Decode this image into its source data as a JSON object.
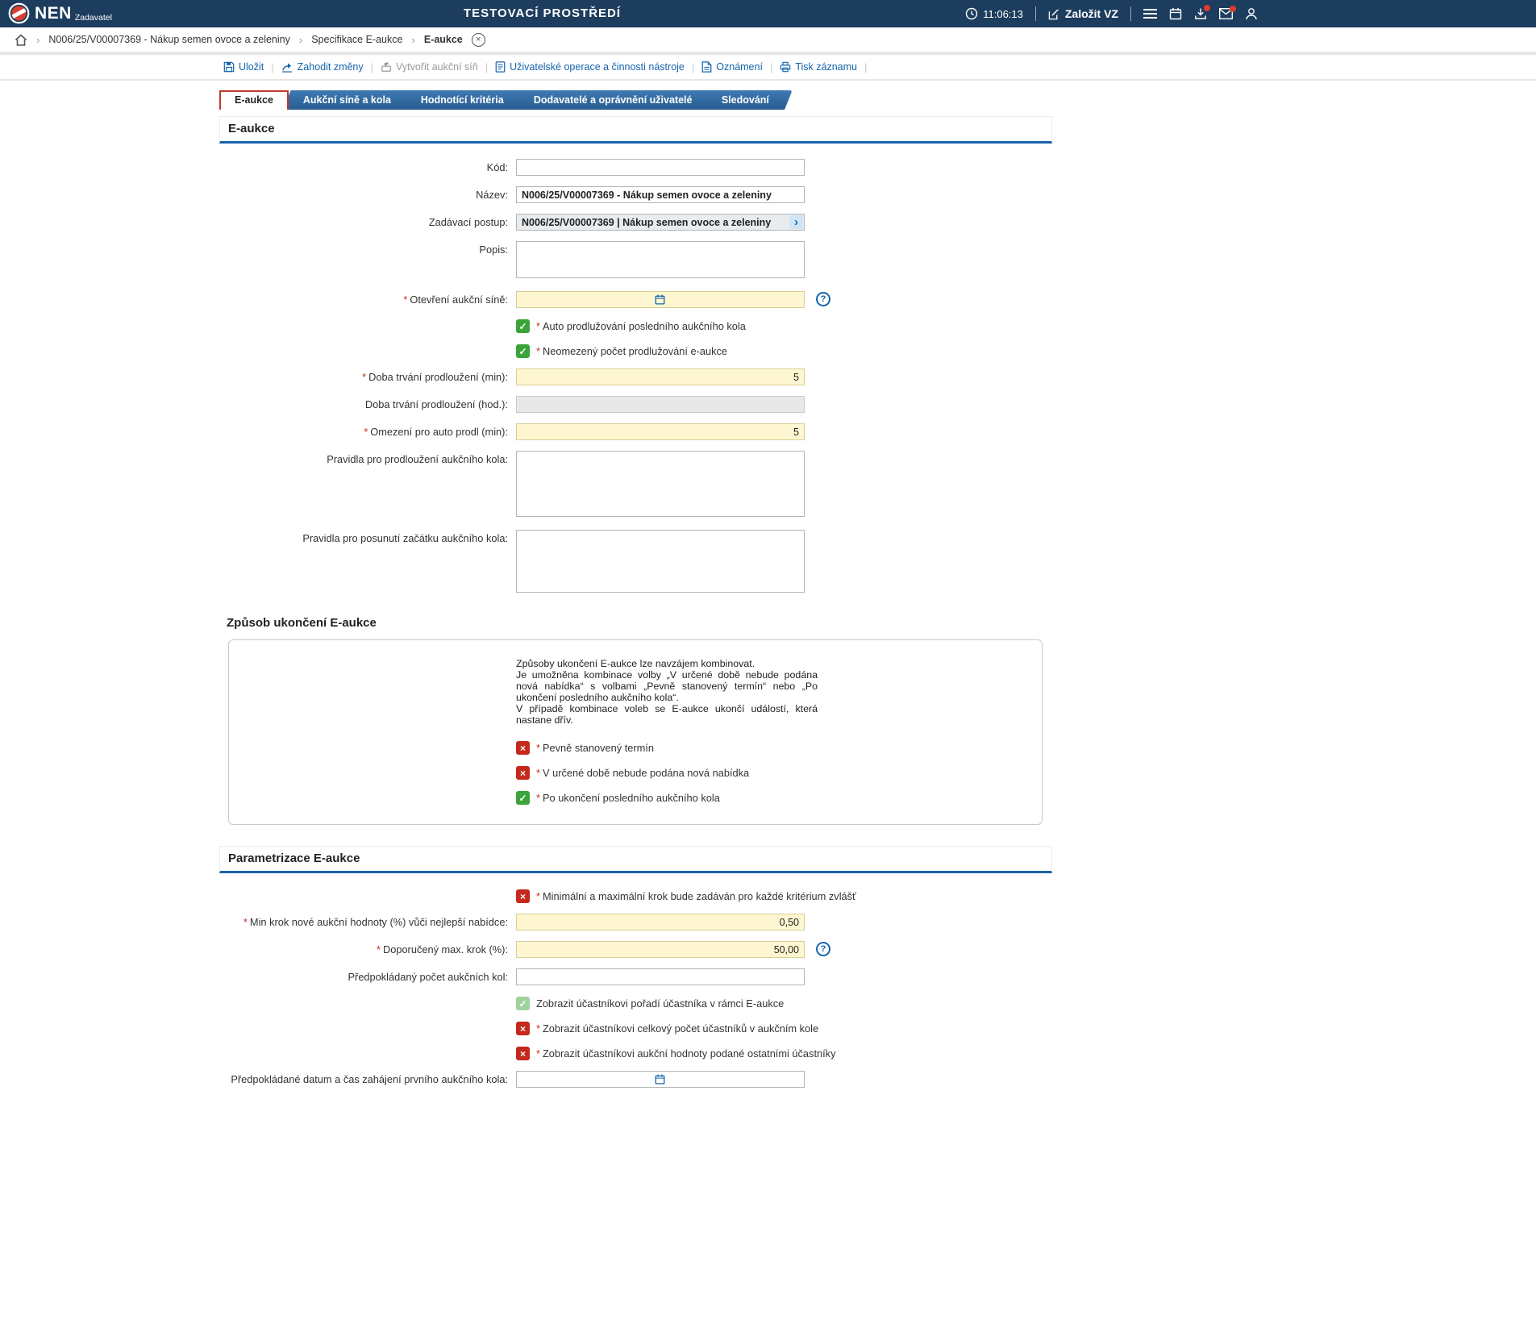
{
  "misc": {
    "required_mark": "*"
  },
  "icons": {
    "chevron_right": "›",
    "close": "×",
    "check": "✓",
    "cross": "×",
    "question": "?",
    "breadcrumb_sep": "›"
  },
  "header": {
    "logo_text": "NEN",
    "logo_subtext": "Zadavatel",
    "environment_title": "TESTOVACÍ PROSTŘEDÍ",
    "clock_time": "11:06:13",
    "create_vz_label": "Založit VZ"
  },
  "breadcrumb": {
    "item1": "N006/25/V00007369 - Nákup semen ovoce a zeleniny",
    "item2": "Specifikace E-aukce",
    "item3": "E-aukce"
  },
  "toolbar": {
    "save": "Uložit",
    "discard": "Zahodit změny",
    "create_room": "Vytvořit aukční síň",
    "user_operations": "Uživatelské operace a činnosti nástroje",
    "announcement": "Oznámení",
    "print": "Tisk záznamu"
  },
  "tabs": {
    "tab1": "E-aukce",
    "tab2": "Aukční síně a kola",
    "tab3": "Hodnotící kritéria",
    "tab4": "Dodavatelé a oprávnění uživatelé",
    "tab5": "Sledování"
  },
  "section_eaukce": {
    "title": "E-aukce",
    "kod_label": "Kód:",
    "kod_value": "",
    "nazev_label": "Název:",
    "nazev_value": "N006/25/V00007369 - Nákup semen ovoce a zeleniny",
    "zadavaci_label": "Zadávací postup:",
    "zadavaci_value": "N006/25/V00007369 | Nákup semen ovoce a zeleniny",
    "popis_label": "Popis:",
    "popis_value": "",
    "otevreni_label": "Otevření aukční síně:",
    "otevreni_value": "",
    "auto_prodl_label": "Auto prodlužování posledního aukčního kola",
    "auto_prodl_checked": true,
    "neomezeny_label": "Neomezený počet prodlužování e-aukce",
    "neomezeny_checked": true,
    "doba_min_label": "Doba trvání prodloužení (min):",
    "doba_min_value": "5",
    "doba_hod_label": "Doba trvání prodloužení (hod.):",
    "doba_hod_value": "",
    "omezeni_label": "Omezení pro auto prodl (min):",
    "omezeni_value": "5",
    "pravidla_prodl_label": "Pravidla pro prodloužení aukčního kola:",
    "pravidla_prodl_value": "",
    "pravidla_posun_label": "Pravidla pro posunutí začátku aukčního kola:",
    "pravidla_posun_value": ""
  },
  "section_zpusob": {
    "title": "Způsob ukončení E-aukce",
    "info_line1": "Způsoby ukončení E-aukce lze navzájem kombinovat.",
    "info_line2": "Je umožněna kombinace volby „V určené době nebude podána nová nabídka“ s volbami „Pevně stanovený termín“ nebo „Po ukončení posledního aukčního kola“.",
    "info_line3": "V případě kombinace voleb se E-aukce ukončí událostí, která nastane dřív.",
    "pevny_label": "Pevně stanovený termín",
    "pevny_checked": false,
    "urcena_label": "V určené době nebude podána nová nabídka",
    "urcena_checked": false,
    "po_ukonceni_label": "Po ukončení posledního aukčního kola",
    "po_ukonceni_checked": true
  },
  "section_parametrizace": {
    "title": "Parametrizace E-aukce",
    "min_max_label": "Minimální a maximální krok bude zadáván pro každé kritérium zvlášť",
    "min_max_checked": false,
    "min_krok_label": "Min krok nové aukční hodnoty (%) vůči nejlepší nabídce:",
    "min_krok_value": "0,50",
    "max_krok_label": "Doporučený max. krok (%):",
    "max_krok_value": "50,00",
    "pocet_kol_label": "Předpokládaný počet aukčních kol:",
    "pocet_kol_value": "",
    "poradi_label": "Zobrazit účastníkovi pořadí účastníka v rámci E-aukce",
    "poradi_checked": true,
    "celkovy_label": "Zobrazit účastníkovi celkový počet účastníků v aukčním kole",
    "celkovy_checked": false,
    "hodnoty_label": "Zobrazit účastníkovi aukční hodnoty podané ostatními účastníky",
    "hodnoty_checked": false,
    "datum_label": "Předpokládané datum a čas zahájení prvního aukčního kola:",
    "datum_value": ""
  }
}
